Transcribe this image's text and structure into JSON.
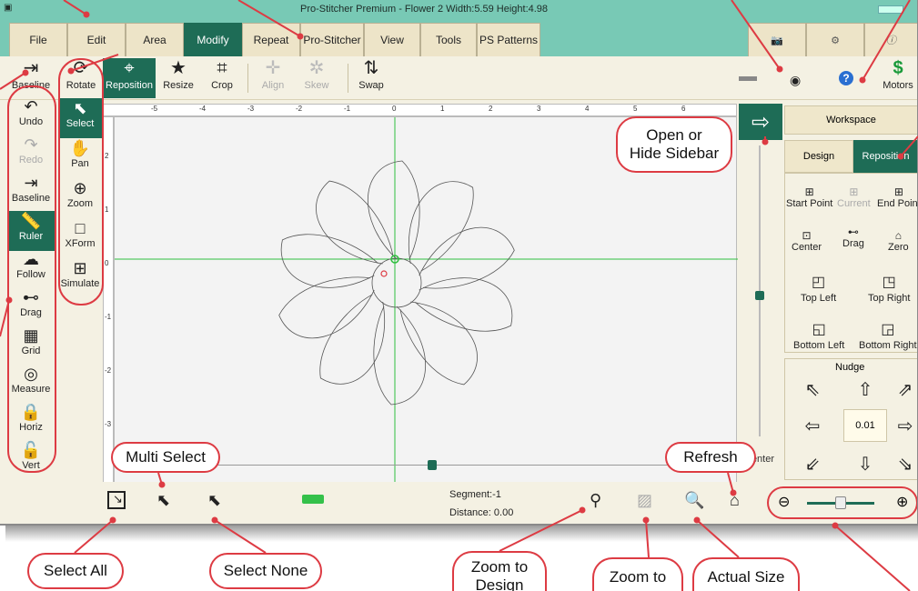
{
  "window": {
    "title": "Pro-Stitcher Premium  -  Flower 2  Width:5.59  Height:4.98",
    "app_icon": "app-icon"
  },
  "menu": {
    "tabs": [
      {
        "label": "File",
        "active": false
      },
      {
        "label": "Edit",
        "active": false
      },
      {
        "label": "Area",
        "active": false
      },
      {
        "label": "Modify",
        "active": true
      },
      {
        "label": "Repeat",
        "active": false
      },
      {
        "label": "Pro-Stitcher",
        "active": false
      },
      {
        "label": "View",
        "active": false
      },
      {
        "label": "Tools",
        "active": false
      },
      {
        "label": "PS Patterns",
        "active": false
      }
    ],
    "right_icons": [
      "camera-icon",
      "gear-icon",
      "info-icon"
    ]
  },
  "ribbon": {
    "left_tools": [
      {
        "label": "Baseline",
        "icon": "baseline-icon"
      },
      {
        "label": "Rotate",
        "icon": "rotate-icon"
      }
    ],
    "tools": [
      {
        "label": "Reposition",
        "icon": "reposition-icon",
        "active": true,
        "disabled": false
      },
      {
        "label": "Resize",
        "icon": "resize-icon",
        "active": false,
        "disabled": false
      },
      {
        "label": "Crop",
        "icon": "crop-icon",
        "active": false,
        "disabled": false
      },
      {
        "label": "Align",
        "icon": "align-icon",
        "active": false,
        "disabled": true
      },
      {
        "label": "Skew",
        "icon": "skew-icon",
        "active": false,
        "disabled": true
      },
      {
        "label": "Swap",
        "icon": "swap-icon",
        "active": false,
        "disabled": false
      }
    ],
    "right": {
      "motors_label": "Motors",
      "wifi_icon": "wifi-icon",
      "help_icon": "help-icon"
    }
  },
  "left_toolbar": [
    {
      "label": "Undo",
      "icon": "undo-icon",
      "disabled": false,
      "active": false
    },
    {
      "label": "Redo",
      "icon": "redo-icon",
      "disabled": true,
      "active": false
    },
    {
      "label": "Baseline",
      "icon": "baseline-icon",
      "disabled": false,
      "active": false
    },
    {
      "label": "Ruler",
      "icon": "ruler-icon",
      "disabled": false,
      "active": true
    },
    {
      "label": "Follow",
      "icon": "follow-icon",
      "disabled": false,
      "active": false
    },
    {
      "label": "Drag",
      "icon": "drag-icon",
      "disabled": false,
      "active": false
    },
    {
      "label": "Grid",
      "icon": "grid-icon",
      "disabled": false,
      "active": false
    },
    {
      "label": "Measure",
      "icon": "measure-icon",
      "disabled": false,
      "active": false
    },
    {
      "label": "Horiz",
      "icon": "horiz-lock-icon",
      "disabled": false,
      "active": false
    },
    {
      "label": "Vert",
      "icon": "vert-lock-icon",
      "disabled": false,
      "active": false
    }
  ],
  "tool_palette": [
    {
      "label": "Select",
      "icon": "select-icon",
      "active": true
    },
    {
      "label": "Pan",
      "icon": "pan-icon",
      "active": false
    },
    {
      "label": "Zoom",
      "icon": "zoom-icon",
      "active": false
    },
    {
      "label": "XForm",
      "icon": "xform-icon",
      "active": false
    },
    {
      "label": "Simulate",
      "icon": "simulate-icon",
      "active": false
    }
  ],
  "rulers": {
    "top_ticks": [
      "-5",
      "-4",
      "-3",
      "-2",
      "-1",
      "0",
      "1",
      "2",
      "3",
      "4",
      "5",
      "6"
    ],
    "left_ticks": [
      "2",
      "1",
      "0",
      "-1",
      "-2",
      "-3"
    ]
  },
  "canvas": {
    "petal_count": 10,
    "center_label": "Center"
  },
  "sidebar": {
    "toggle_icon": "arrow-right-icon",
    "workspace_label": "Workspace",
    "tabs": [
      {
        "label": "Design",
        "active": false
      },
      {
        "label": "Reposition",
        "active": true
      }
    ],
    "reposition_buttons": [
      {
        "label": "Start Point",
        "disabled": false
      },
      {
        "label": "Current",
        "disabled": true
      },
      {
        "label": "End Point",
        "disabled": false
      },
      {
        "label": "Center",
        "disabled": false
      },
      {
        "label": "Drag",
        "disabled": false
      },
      {
        "label": "Zero",
        "disabled": false
      },
      {
        "label": "Top Left",
        "disabled": false
      },
      {
        "label": "Top Right",
        "disabled": false
      },
      {
        "label": "Bottom Left",
        "disabled": false
      },
      {
        "label": "Bottom Right",
        "disabled": false
      }
    ],
    "nudge": {
      "title": "Nudge",
      "value": "0.01"
    }
  },
  "status": {
    "segment_label": "Segment:",
    "segment_value": "-1",
    "distance_label": "Distance:",
    "distance_value": "0.00"
  },
  "callouts": {
    "open_hide_sidebar": "Open or\nHide Sidebar",
    "multi_select": "Multi Select",
    "refresh": "Refresh",
    "select_all": "Select All",
    "select_none": "Select None",
    "zoom_to_design": "Zoom to\nDesign",
    "zoom_to": "Zoom to",
    "actual_size": "Actual Size"
  },
  "colors": {
    "accent": "#1e6c56",
    "titlebar": "#78c9b5",
    "callout_red": "#dd3b43",
    "guide_green": "#2fbf3f"
  }
}
